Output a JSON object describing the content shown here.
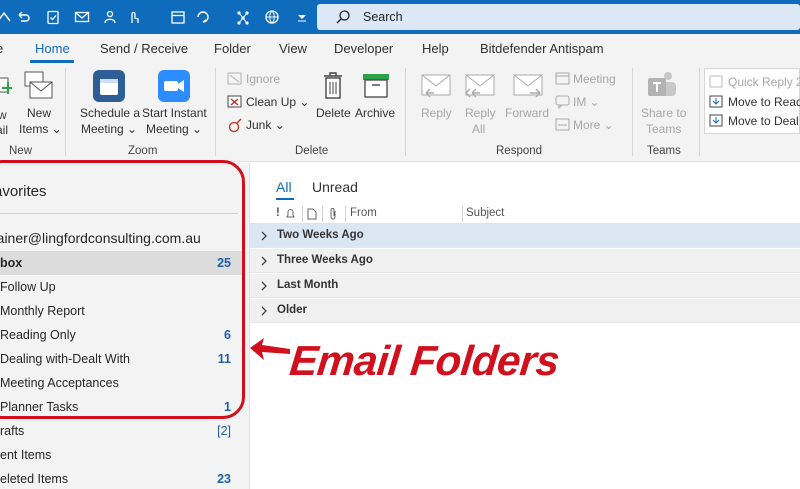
{
  "search": {
    "label": "Search"
  },
  "tabs": [
    {
      "label": "Home",
      "active": true
    },
    {
      "label": "Send / Receive"
    },
    {
      "label": "Folder"
    },
    {
      "label": "View"
    },
    {
      "label": "Developer"
    },
    {
      "label": "Help"
    },
    {
      "label": "Bitdefender Antispam"
    }
  ],
  "ribbon": {
    "new": {
      "new_email_partial": "w",
      "new_email_line2": "ail",
      "new_items_l1": "New",
      "new_items_l2": "Items",
      "group": "New"
    },
    "zoom": {
      "schedule_l1": "Schedule a",
      "schedule_l2": "Meeting",
      "instant_l1": "Start Instant",
      "instant_l2": "Meeting",
      "group": "Zoom"
    },
    "delete": {
      "ignore": "Ignore",
      "cleanup": "Clean Up",
      "junk": "Junk",
      "delete": "Delete",
      "archive": "Archive",
      "group": "Delete"
    },
    "respond": {
      "reply": "Reply",
      "reply_all_l1": "Reply",
      "reply_all_l2": "All",
      "forward": "Forward",
      "meeting": "Meeting",
      "im": "IM",
      "more": "More",
      "group": "Respond"
    },
    "teams": {
      "share_l1": "Share to",
      "share_l2": "Teams",
      "group": "Teams"
    },
    "quicksteps": {
      "quick_reply": "Quick Reply 2",
      "move_read": "Move to Read",
      "move_deal": "Move to Deal"
    }
  },
  "folders": {
    "favorites_title": "avorites",
    "account": "rainer@lingfordconsulting.com.au",
    "items": [
      {
        "name": "box",
        "count": "25",
        "selected": true,
        "bold": true
      },
      {
        "name": "Follow Up",
        "count": ""
      },
      {
        "name": "Monthly Report",
        "count": ""
      },
      {
        "name": "Reading Only",
        "count": "6"
      },
      {
        "name": "Dealing with-Dealt With",
        "count": "11"
      },
      {
        "name": "Meeting Acceptances",
        "count": ""
      },
      {
        "name": "Planner Tasks",
        "count": "1"
      },
      {
        "name": "rafts",
        "count": "[2]"
      },
      {
        "name": "ent Items",
        "count": ""
      },
      {
        "name": "eleted Items",
        "count": "23"
      }
    ]
  },
  "callout": "Email Folders",
  "message_list": {
    "tab_all": "All",
    "tab_unread": "Unread",
    "col_from": "From",
    "col_subject": "Subject",
    "groups": [
      "Two Weeks Ago",
      "Three Weeks Ago",
      "Last Month",
      "Older"
    ]
  },
  "colors": {
    "accent": "#0f6cbd",
    "callout_red": "#d10f1d",
    "count_blue": "#1d5fa8"
  }
}
